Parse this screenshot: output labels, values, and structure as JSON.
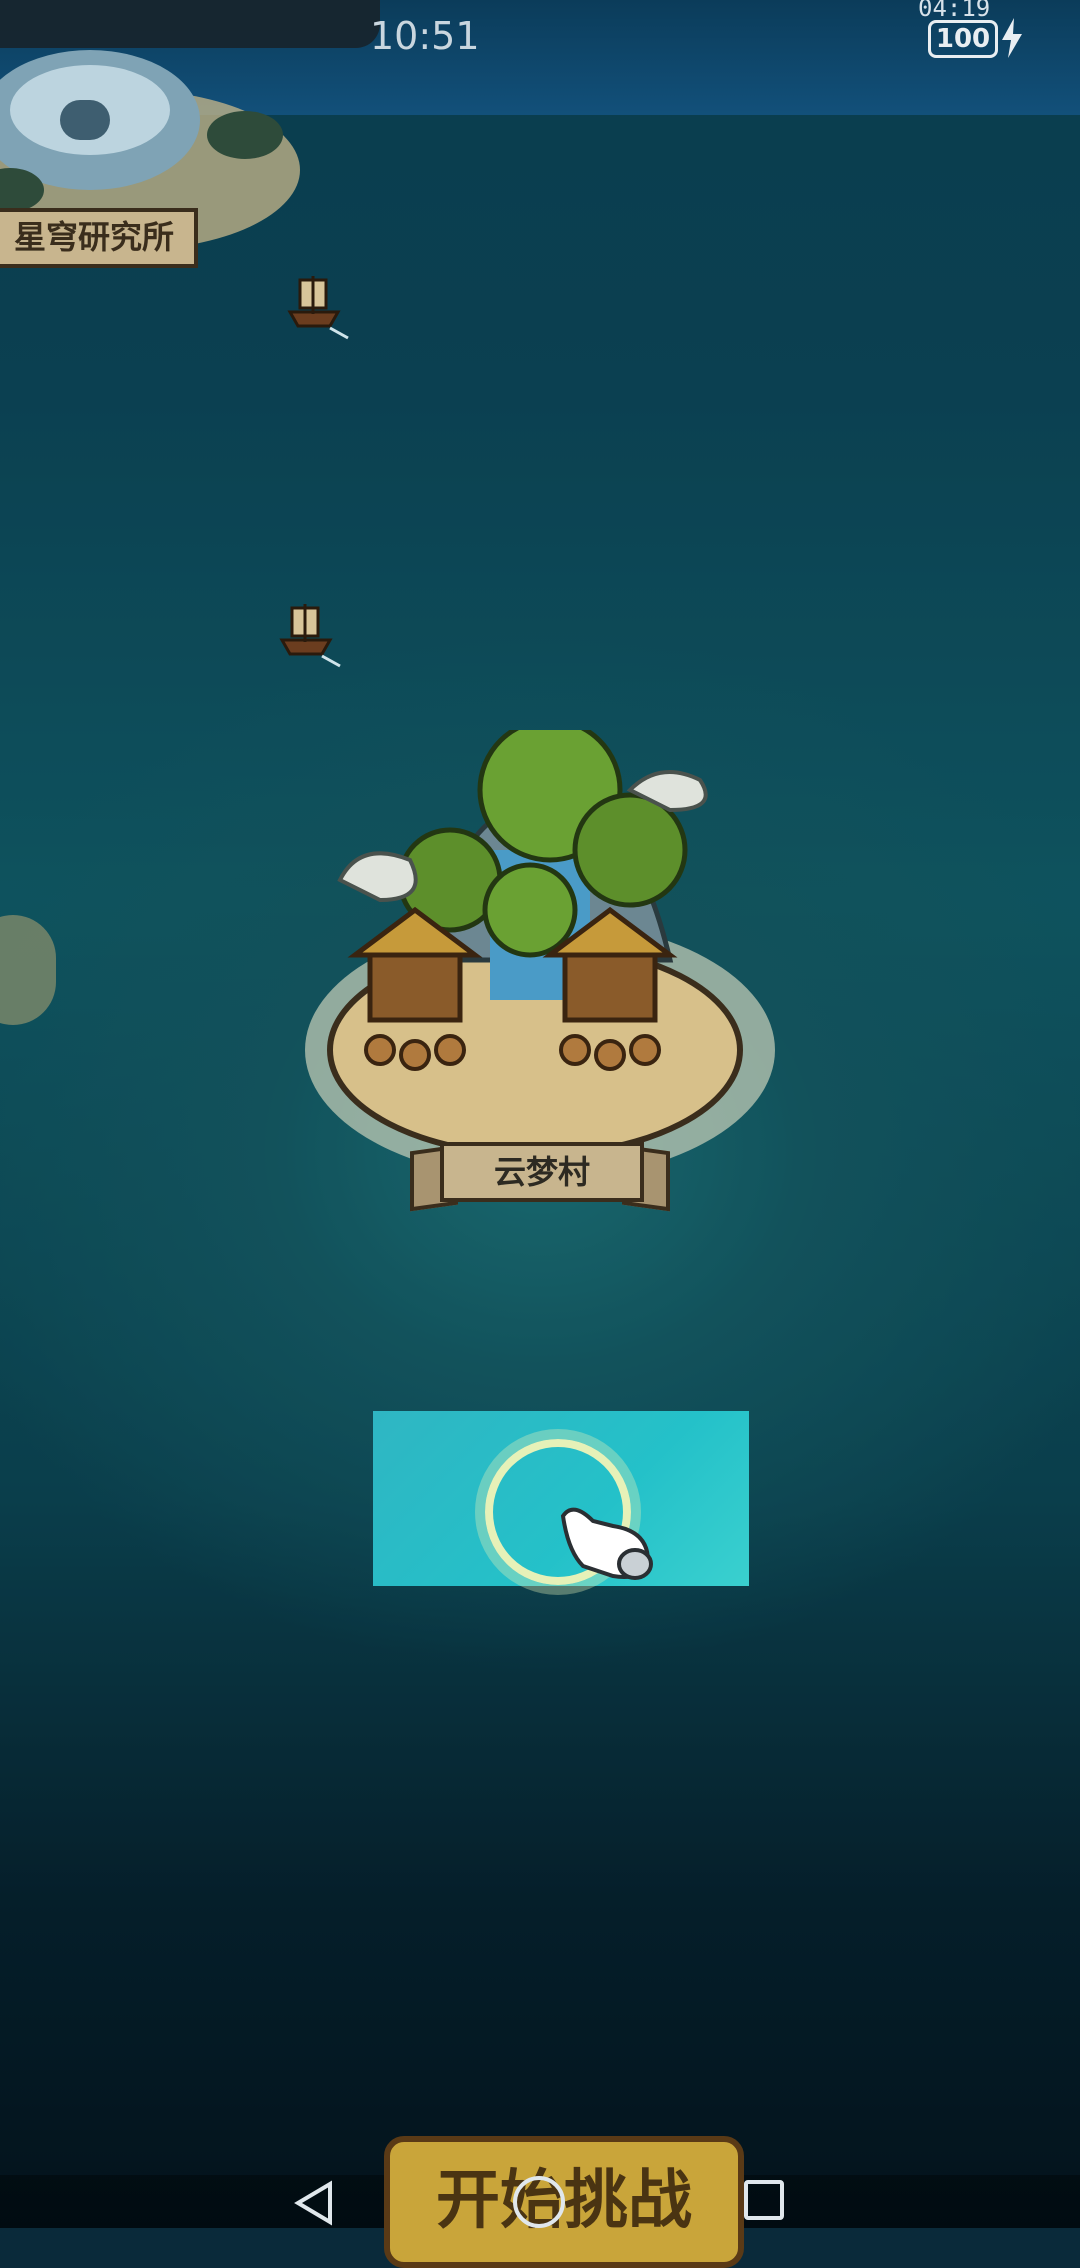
{
  "status_bar": {
    "time": "10:51",
    "top_right_time": "04:19",
    "battery_level": "100"
  },
  "map": {
    "research_station_label": "星穹研究所",
    "village_label": "云梦村"
  },
  "tutorial": {
    "hint_icon": "tap-hand-icon"
  },
  "start_button_label": "开始挑战",
  "navigation": {
    "back_icon": "back-triangle-icon",
    "home_icon": "home-circle-icon",
    "recents_icon": "recents-square-icon"
  }
}
